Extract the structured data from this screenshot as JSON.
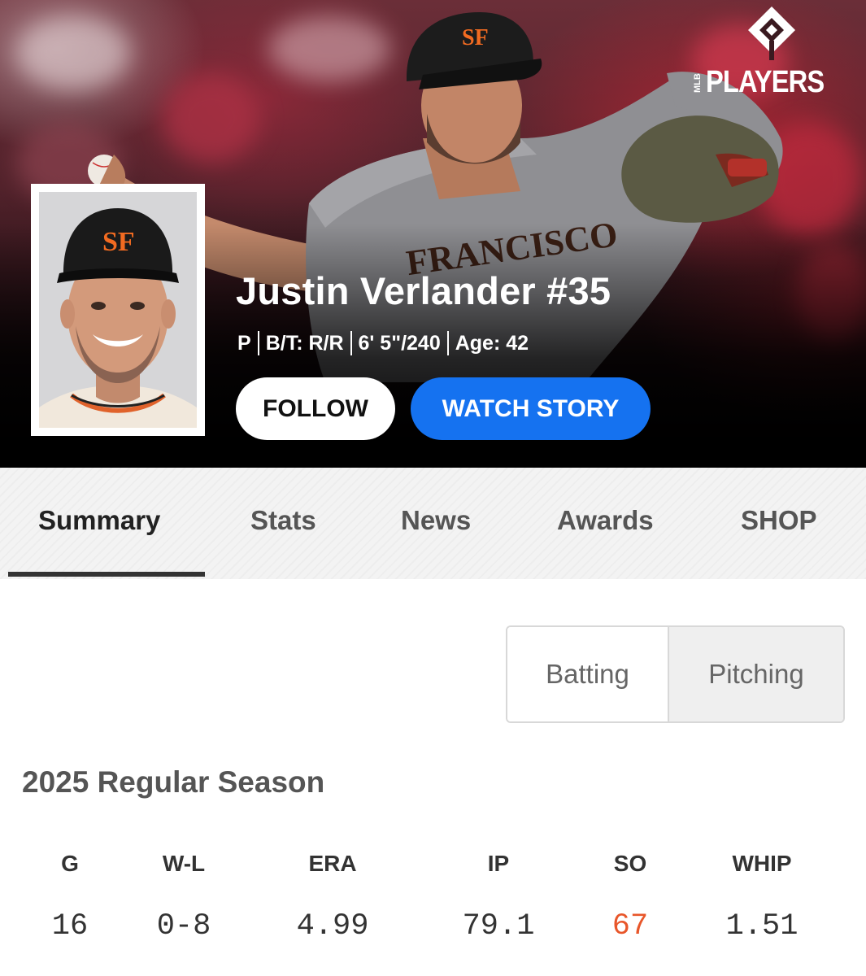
{
  "brand": {
    "logo_text": "PLAYERS",
    "logo_prefix": "MLB",
    "accent_blue": "#1572f0",
    "highlight_orange": "#e8562a"
  },
  "player": {
    "name": "Justin Verlander #35",
    "position": "P",
    "bats_throws": "B/T: R/R",
    "height_weight": "6' 5\"/240",
    "age": "Age: 42",
    "cap_logo": "SF",
    "jersey_text": "SAN FRANCISCO"
  },
  "actions": {
    "follow_label": "FOLLOW",
    "watch_story_label": "WATCH STORY"
  },
  "tabs": [
    {
      "label": "Summary",
      "active": true
    },
    {
      "label": "Stats",
      "active": false
    },
    {
      "label": "News",
      "active": false
    },
    {
      "label": "Awards",
      "active": false
    },
    {
      "label": "SHOP",
      "active": false
    }
  ],
  "segmented": {
    "options": [
      "Batting",
      "Pitching"
    ],
    "selected": "Pitching"
  },
  "season": {
    "title": "2025 Regular Season",
    "columns": [
      "G",
      "W-L",
      "ERA",
      "IP",
      "SO",
      "WHIP"
    ],
    "values": [
      "16",
      "0-8",
      "4.99",
      "79.1",
      "67",
      "1.51"
    ],
    "highlighted_column": "SO"
  },
  "icons": {
    "logo_mark": "mlbpa-diamond-icon",
    "headshot": "player-headshot-image",
    "hero": "pitching-action-photo"
  }
}
